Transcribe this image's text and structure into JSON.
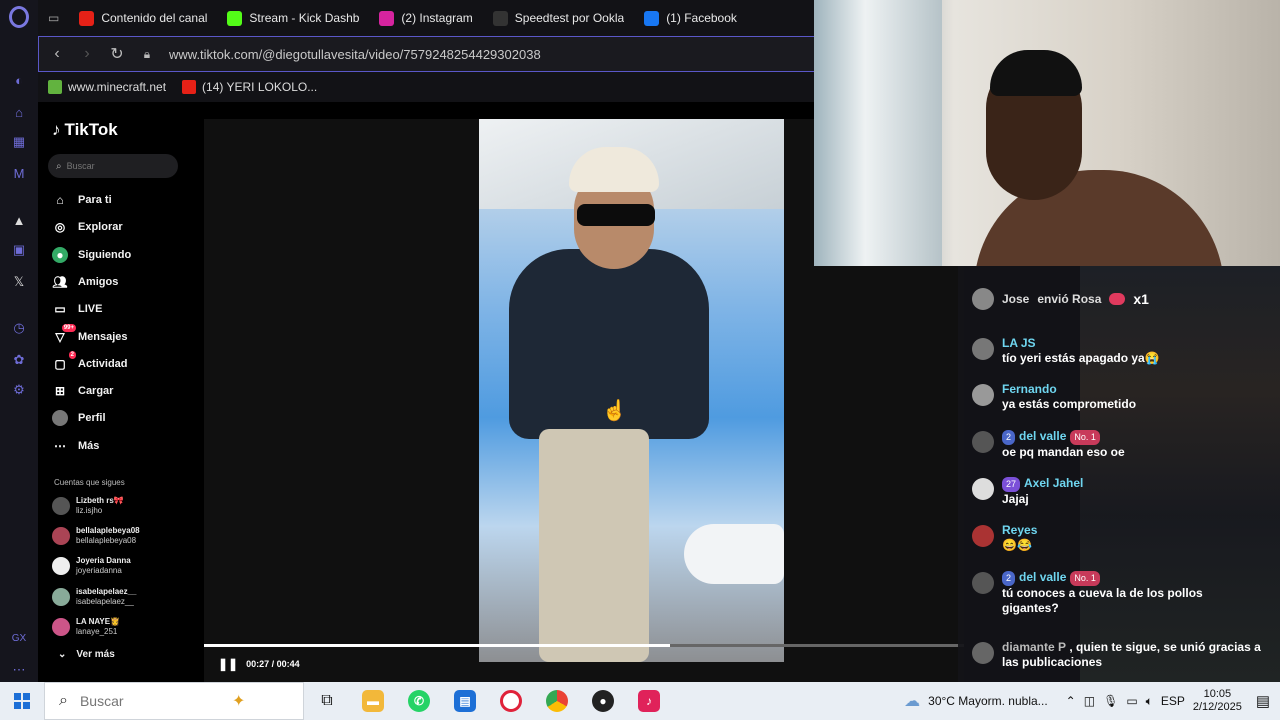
{
  "tabs": [
    {
      "title": "Contenido del canal",
      "color": "#e62117",
      "icon": "youtube-icon"
    },
    {
      "title": "Stream - Kick Dashboard",
      "color": "#53fc18",
      "icon": "kick-icon"
    },
    {
      "title": "(2) Instagram",
      "color": "#d6249f",
      "icon": "instagram-icon"
    },
    {
      "title": "Speedtest por Ookla",
      "color": "#333333",
      "icon": "speedtest-icon"
    },
    {
      "title": "(1) Facebook",
      "color": "#1877f2",
      "icon": "facebook-icon"
    }
  ],
  "address": {
    "url": "www.tiktok.com/@diegotullavesita/video/7579248254429302038"
  },
  "bookmarks": [
    {
      "label": "www.minecraft.net",
      "color": "#62b33f",
      "icon": "minecraft-icon"
    },
    {
      "label": "(14) YERI LOKOLO...",
      "color": "#e62117",
      "icon": "youtube-icon"
    }
  ],
  "tiktok": {
    "logo": "TikTok",
    "search_placeholder": "Buscar",
    "nav": [
      {
        "label": "Para ti",
        "icon": "home-icon"
      },
      {
        "label": "Explorar",
        "icon": "compass-icon"
      },
      {
        "label": "Siguiendo",
        "icon": "following-icon"
      },
      {
        "label": "Amigos",
        "icon": "friends-icon"
      },
      {
        "label": "LIVE",
        "icon": "live-icon"
      },
      {
        "label": "Mensajes",
        "icon": "messages-icon",
        "badge": "99+"
      },
      {
        "label": "Actividad",
        "icon": "activity-icon",
        "badge": "2"
      },
      {
        "label": "Cargar",
        "icon": "upload-icon"
      },
      {
        "label": "Perfil",
        "icon": "profile-icon"
      },
      {
        "label": "Más",
        "icon": "more-icon"
      }
    ],
    "following_title": "Cuentas que sigues",
    "following": [
      {
        "name": "Lizbeth rs🎀",
        "handle": "liz.isjho"
      },
      {
        "name": "bellalaplebeya08",
        "handle": "bellalaplebeya08"
      },
      {
        "name": "Joyeria Danna",
        "handle": "joyeriadanna"
      },
      {
        "name": "isabelapelaez__",
        "handle": "isabelapelaez__"
      },
      {
        "name": "LA NAYE👸",
        "handle": "lanaye_251"
      }
    ],
    "see_more": "Ver más",
    "player": {
      "time": "00:27 / 00:44",
      "progress_fraction": 0.6136,
      "username": "diegotullavesita"
    }
  },
  "chat": {
    "gift": {
      "user": "Jose",
      "text": "envió Rosa",
      "count": "x1"
    },
    "messages": [
      {
        "user": "LA JS",
        "text": "tío yeri estás apagado ya😭"
      },
      {
        "user": "Fernando",
        "text": "ya estás comprometido"
      },
      {
        "user": "del valle",
        "level": "2",
        "rank": "No. 1",
        "text": "oe pq mandan eso oe"
      },
      {
        "user": "Axel Jahel",
        "level": "27",
        "text": "Jajaj"
      },
      {
        "user": "Reyes",
        "text": "😄😂"
      },
      {
        "user": "del valle",
        "level": "2",
        "rank": "No. 1",
        "text": "tú conoces a cueva la de los pollos gigantes?"
      },
      {
        "user": "diamante P",
        "text": ", quien te sigue, se unió gracias a las publicaciones"
      }
    ]
  },
  "taskbar": {
    "search_placeholder": "Buscar",
    "weather": "30°C  Mayorm. nubla...",
    "lang": "ESP",
    "time": "10:05",
    "date": "2/12/2025"
  }
}
